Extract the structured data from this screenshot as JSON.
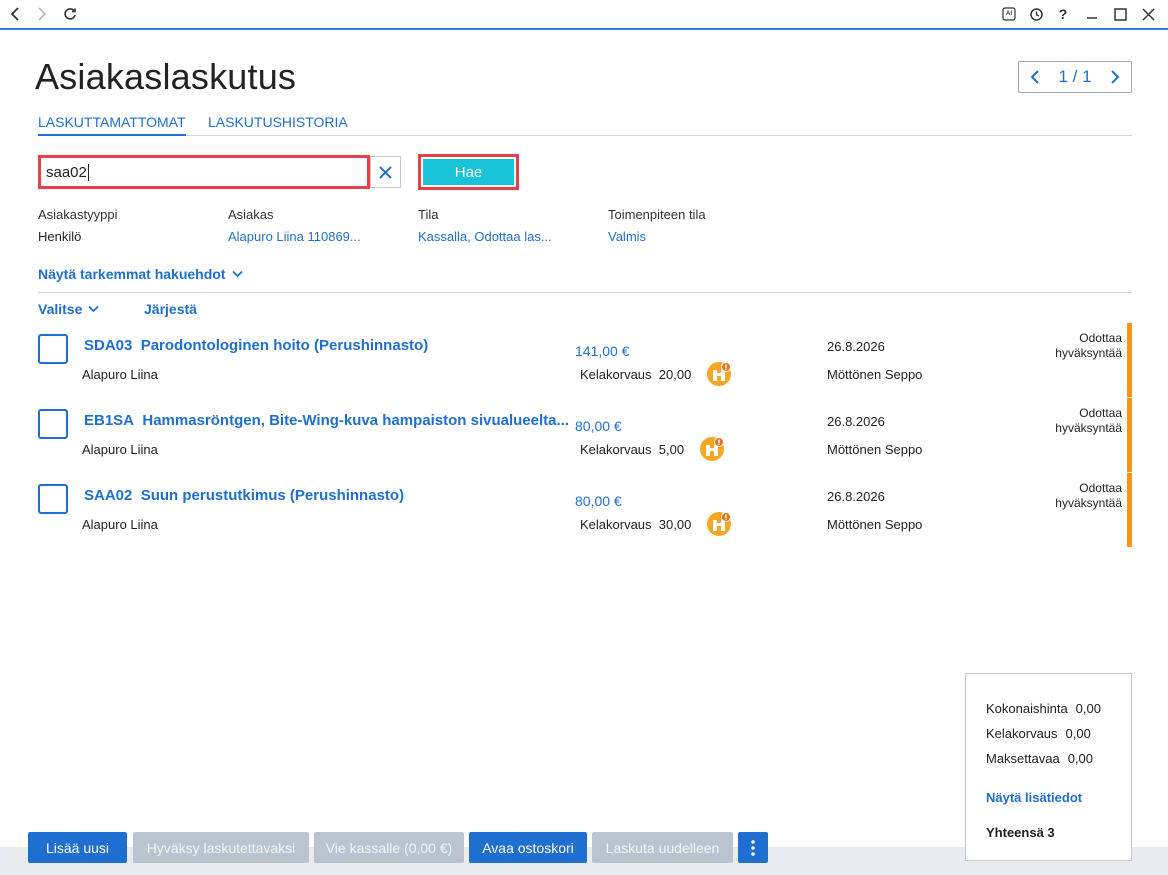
{
  "window": {
    "ai_badge": "AI"
  },
  "header": {
    "title": "Asiakaslaskutus",
    "pager": "1 / 1"
  },
  "tabs": [
    {
      "label": "LASKUTTAMATTOMAT",
      "active": true
    },
    {
      "label": "LASKUTUSHISTORIA",
      "active": false
    }
  ],
  "search": {
    "value": "saa02",
    "button_label": "Hae"
  },
  "filters": [
    {
      "label": "Asiakastyyppi",
      "value": "Henkilö"
    },
    {
      "label": "Asiakas",
      "value": "Alapuro Liina 110869..."
    },
    {
      "label": "Tila",
      "value": "Kassalla, Odottaa las..."
    },
    {
      "label": "Toimenpiteen tila",
      "value": "Valmis"
    }
  ],
  "more_filters_label": "Näytä tarkemmat hakuehdot",
  "list_controls": {
    "select_label": "Valitse",
    "sort_label": "Järjestä"
  },
  "rows": [
    {
      "code": "SDA03",
      "title": "Parodontologinen hoito (Perushinnasto)",
      "customer": "Alapuro Liina",
      "price": "141,00 €",
      "kela_label": "Kelakorvaus",
      "kela_value": "20,00",
      "date": "26.8.2026",
      "worker": "Möttönen Seppo",
      "status": "Odottaa hyväksyntää"
    },
    {
      "code": "EB1SA",
      "title": "Hammasröntgen, Bite-Wing-kuva hampaiston sivualueelta...",
      "customer": "Alapuro Liina",
      "price": "80,00 €",
      "kela_label": "Kelakorvaus",
      "kela_value": "5,00",
      "date": "26.8.2026",
      "worker": "Möttönen Seppo",
      "status": "Odottaa hyväksyntää"
    },
    {
      "code": "SAA02",
      "title": "Suun perustutkimus (Perushinnasto)",
      "customer": "Alapuro Liina",
      "price": "80,00 €",
      "kela_label": "Kelakorvaus",
      "kela_value": "30,00",
      "date": "26.8.2026",
      "worker": "Möttönen Seppo",
      "status": "Odottaa hyväksyntää"
    }
  ],
  "summary": {
    "total_price_label": "Kokonaishinta",
    "total_price_value": "0,00",
    "kela_label": "Kelakorvaus",
    "kela_value": "0,00",
    "payable_label": "Maksettavaa",
    "payable_value": "0,00",
    "more_label": "Näytä lisätiedot",
    "count_label": "Yhteensä 3"
  },
  "bottom_buttons": {
    "add_new": "Lisää uusi",
    "approve": "Hyväksy laskutettavaksi",
    "to_cashier": "Vie kassalle (0,00 €)",
    "open_cart": "Avaa ostoskori",
    "reinvoice": "Laskuta uudelleen"
  },
  "colors": {
    "accent": "#1f6fd1",
    "search_button": "#19c3d8",
    "highlight": "#e8404a",
    "status_bar": "#f7941d"
  }
}
